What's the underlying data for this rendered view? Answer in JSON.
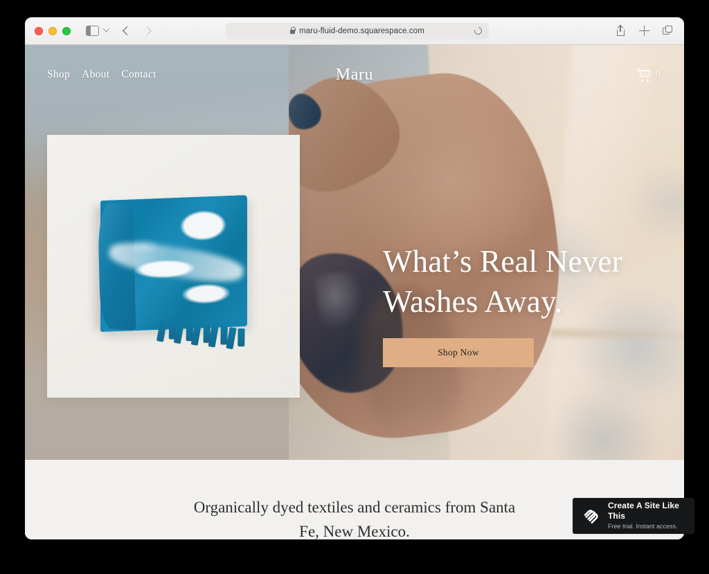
{
  "browser": {
    "url": "maru-fluid-demo.squarespace.com",
    "lock_icon": "lock-icon",
    "reload_icon": "reload-icon",
    "sidebar_icon": "sidebar-toggle-icon",
    "chevron_icon": "chevron-down-icon",
    "back_icon": "back-arrow-icon",
    "forward_icon": "forward-arrow-icon",
    "share_icon": "share-icon",
    "new_tab_icon": "plus-icon",
    "tabs_icon": "tab-overview-icon",
    "traffic_lights": [
      "close-red",
      "minimize-yellow",
      "zoom-green"
    ]
  },
  "site": {
    "brand": "Maru",
    "nav": [
      {
        "label": "Shop"
      },
      {
        "label": "About"
      },
      {
        "label": "Contact"
      }
    ],
    "cart": {
      "icon": "shopping-cart-icon",
      "count": "0"
    },
    "hero": {
      "title_line1": "What’s Real Never",
      "title_line2": "Washes Away.",
      "cta_label": "Shop Now",
      "cta_color": "#dfae85",
      "product_image_alt": "indigo-tie-dye-textile"
    },
    "intro": {
      "text": "Organically dyed textiles and ceramics from Santa Fe, New Mexico."
    }
  },
  "squarespace_badge": {
    "title": "Create A Site Like This",
    "subtitle": "Free trial. Instant access.",
    "logo": "squarespace-logo-icon",
    "background": "#16181a"
  }
}
